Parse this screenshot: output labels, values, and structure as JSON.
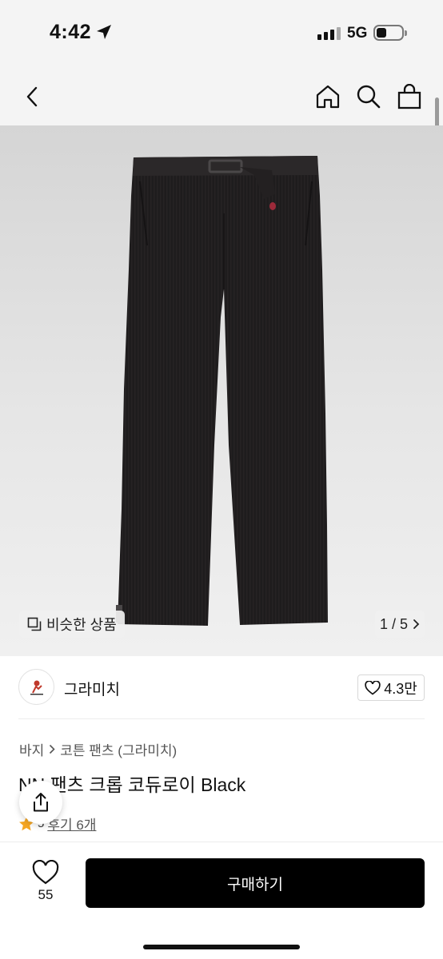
{
  "status_bar": {
    "time": "4:42",
    "network": "5G"
  },
  "nav": {
    "icons": [
      "back-chevron-icon",
      "home-icon",
      "search-icon",
      "shopping-bag-icon"
    ]
  },
  "gallery": {
    "similar_label": "비슷한 상품",
    "page_indicator": "1 / 5"
  },
  "brand": {
    "name": "그라미치",
    "likes": "4.3만"
  },
  "breadcrumb": {
    "category": "바지",
    "subcategory": "코튼 팬츠 (그라미치)"
  },
  "product": {
    "title": "NN 팬츠 크롭 코듀로이 Black"
  },
  "rating": {
    "score": "5",
    "reviews": "후기 6개"
  },
  "bottom": {
    "wish_count": "55",
    "buy_label": "구매하기"
  },
  "colors": {
    "accent": "#000000",
    "star": "#f5a623",
    "pants": "#1e1c1d"
  }
}
